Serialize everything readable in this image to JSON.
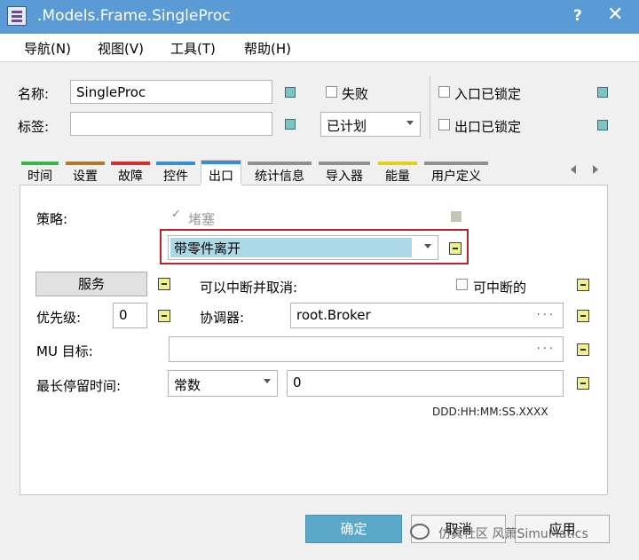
{
  "window": {
    "title": ".Models.Frame.SingleProc",
    "help": "?",
    "close": "✕"
  },
  "menu": [
    "导航(N)",
    "视图(V)",
    "工具(T)",
    "帮助(H)"
  ],
  "header": {
    "name_label": "名称:",
    "name_value": "SingleProc",
    "label_label": "标签:",
    "label_value": "",
    "failed_label": "失败",
    "status_value": "已计划",
    "entrance_locked_label": "入口已锁定",
    "exit_locked_label": "出口已锁定"
  },
  "tabs": [
    {
      "label": "时间",
      "color": "#3cb44b"
    },
    {
      "label": "设置",
      "color": "#b07a2a"
    },
    {
      "label": "故障",
      "color": "#d03030"
    },
    {
      "label": "控件",
      "color": "#3a8fd0"
    },
    {
      "label": "出口",
      "color": "#3a8fd0"
    },
    {
      "label": "统计信息",
      "color": "#909090"
    },
    {
      "label": "导入器",
      "color": "#909090"
    },
    {
      "label": "能量",
      "color": "#e0d020"
    },
    {
      "label": "用户定义",
      "color": "#909090"
    }
  ],
  "active_tab": "出口",
  "exit": {
    "strategy_label": "策略:",
    "blocking_label": "堵塞",
    "strategy_value": "带零件离开",
    "service_button": "服务",
    "interruptible_label": "可以中断并取消:",
    "interruptible_check": "可中断的",
    "priority_label": "优先级:",
    "priority_value": "0",
    "broker_label": "协调器:",
    "broker_value": "root.Broker",
    "mu_target_label": "MU 目标:",
    "mu_target_value": "",
    "max_dwell_label": "最长停留时间:",
    "max_dwell_type": "常数",
    "max_dwell_value": "0",
    "time_format": "DDD:HH:MM:SS.XXXX",
    "dots": "···"
  },
  "footer": {
    "ok": "确定",
    "cancel": "取消",
    "apply": "应用"
  },
  "watermark": "仿真社区 风萧SimuMatics",
  "colors": {
    "titlebar": "#5b9bd5",
    "highlight": "#c0202a",
    "selected_combo": "#add8e6",
    "ok_button": "#5ba8c8"
  }
}
